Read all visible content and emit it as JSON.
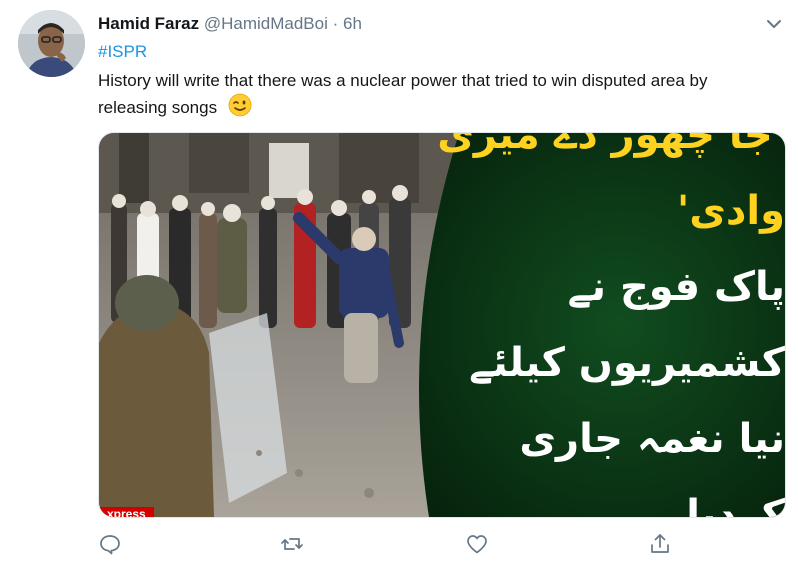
{
  "tweet": {
    "display_name": "Hamid Faraz",
    "handle": "@HamidMadBoi",
    "separator": "·",
    "time": "6h",
    "hashtag": "#ISPR",
    "text": "History will write that there was a nuclear power that tried to win disputed area by releasing songs",
    "emoji": "winking-face"
  },
  "media": {
    "urdu_lines": [
      "'جا چھوڑ دے میری وادی'",
      "پاک فوج نے کشمیریوں کیلئے",
      "نیا نغمہ جاری کردیا"
    ],
    "watermark": "xpress"
  },
  "actions": [
    "reply",
    "retweet",
    "like",
    "share"
  ],
  "colors": {
    "link": "#1b95e0",
    "secondary_text": "#657786",
    "banner_green": "#0c3b17",
    "headline_yellow": "#ffd21f"
  }
}
